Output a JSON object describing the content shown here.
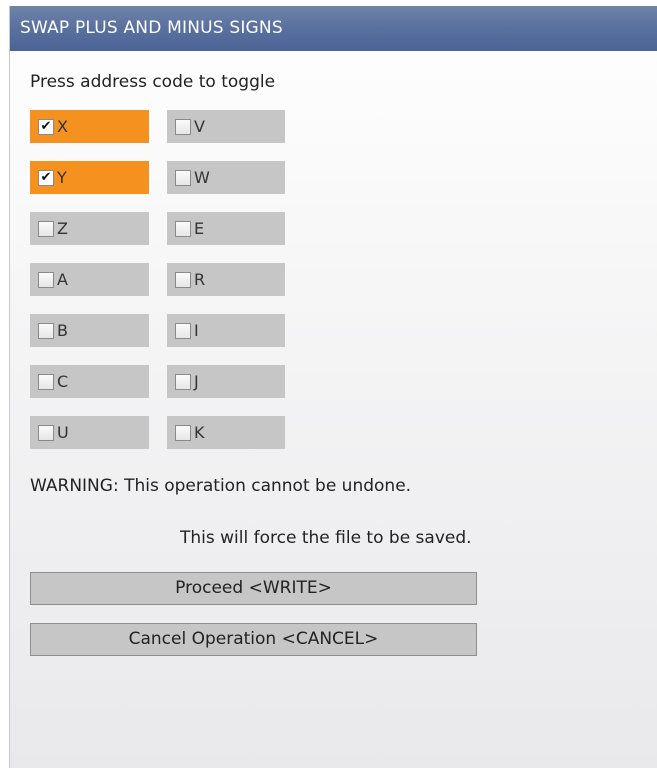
{
  "dialog": {
    "title": "SWAP PLUS AND MINUS SIGNS",
    "instruction": "Press address code to toggle",
    "warning": "WARNING: This operation cannot be undone.",
    "note": "This will force the file to be saved.",
    "proceed_label": "Proceed <WRITE>",
    "cancel_label": "Cancel Operation <CANCEL>"
  },
  "colors": {
    "title_bar": "#5b72a0",
    "selected": "#f5921f",
    "unselected": "#c6c6c6"
  },
  "toggles": {
    "left": [
      {
        "label": "X",
        "checked": true,
        "mark": "✔"
      },
      {
        "label": "Y",
        "checked": true,
        "mark": "✔"
      },
      {
        "label": "Z",
        "checked": false,
        "mark": ""
      },
      {
        "label": "A",
        "checked": false,
        "mark": ""
      },
      {
        "label": "B",
        "checked": false,
        "mark": ""
      },
      {
        "label": "C",
        "checked": false,
        "mark": ""
      },
      {
        "label": "U",
        "checked": false,
        "mark": ""
      }
    ],
    "right": [
      {
        "label": "V",
        "checked": false,
        "mark": ""
      },
      {
        "label": "W",
        "checked": false,
        "mark": ""
      },
      {
        "label": "E",
        "checked": false,
        "mark": ""
      },
      {
        "label": "R",
        "checked": false,
        "mark": ""
      },
      {
        "label": "I",
        "checked": false,
        "mark": ""
      },
      {
        "label": "J",
        "checked": false,
        "mark": ""
      },
      {
        "label": "K",
        "checked": false,
        "mark": ""
      }
    ]
  }
}
